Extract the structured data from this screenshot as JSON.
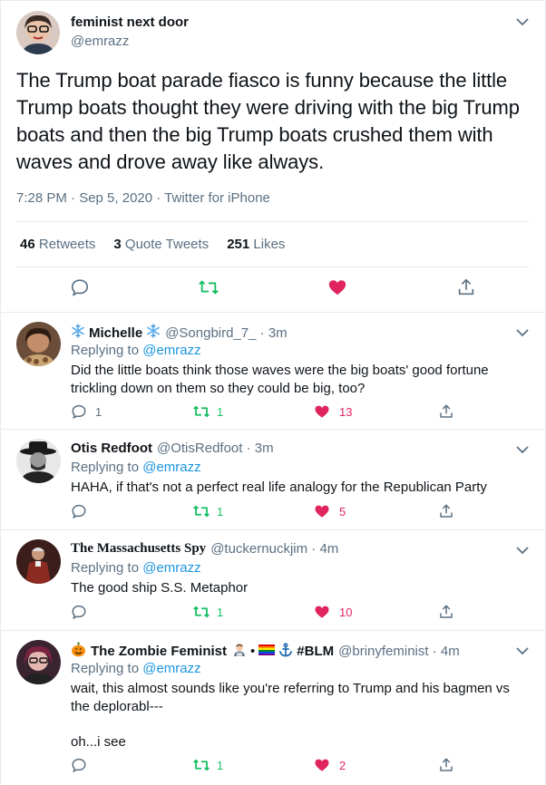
{
  "main_tweet": {
    "author_name": "feminist next door",
    "author_handle": "@emrazz",
    "text": "The Trump boat parade fiasco is funny because the little Trump boats thought they were driving with the big Trump boats and then the big Trump boats crushed them with waves and drove away like always.",
    "meta": "7:28 PM · Sep 5, 2020 · Twitter for iPhone",
    "stats": {
      "retweets_count": "46",
      "retweets_label": "Retweets",
      "quotes_count": "3",
      "quotes_label": "Quote Tweets",
      "likes_count": "251",
      "likes_label": "Likes"
    }
  },
  "replies": [
    {
      "name": "Michelle",
      "handle": "@Songbird_7_",
      "time": "· 3m",
      "replying_prefix": "Replying to",
      "replying_to": "@emrazz",
      "text": "Did the little boats think those waves were the big boats' good fortune trickling down on them so they could be big, too?",
      "reply_count": "1",
      "retweet_count": "1",
      "like_count": "13"
    },
    {
      "name": "Otis Redfoot",
      "handle": "@OtisRedfoot",
      "time": "· 3m",
      "replying_prefix": "Replying to",
      "replying_to": "@emrazz",
      "text": "HAHA, if that's not a perfect real life analogy for the Republican Party",
      "reply_count": "",
      "retweet_count": "1",
      "like_count": "5"
    },
    {
      "name": "The Massachusetts Spy",
      "handle": "@tuckernuckjim",
      "time": "· 4m",
      "replying_prefix": "Replying to",
      "replying_to": "@emrazz",
      "text": "The good ship S.S. Metaphor",
      "reply_count": "",
      "retweet_count": "1",
      "like_count": "10"
    },
    {
      "name": "The Zombie Feminist",
      "name_suffix": "#BLM",
      "handle": "@brinyfeminist",
      "time": "· 4m",
      "replying_prefix": "Replying to",
      "replying_to": "@emrazz",
      "text_line1": "wait, this almost sounds like you're referring to Trump and his bagmen vs the deplorabl---",
      "text_line2": "oh...i see",
      "reply_count": "",
      "retweet_count": "1",
      "like_count": "2"
    }
  ],
  "colors": {
    "text": "#0f1419",
    "secondary": "#5b7083",
    "link": "#1b95e0",
    "retweet_green": "#17bf63",
    "like_red": "#e0245e",
    "divider": "#e6ecf0"
  },
  "icons": [
    "chevron-down-icon",
    "reply-icon",
    "retweet-icon",
    "like-icon",
    "share-icon",
    "snowflake-icon",
    "pumpkin-icon",
    "rainbow-flag-icon",
    "anchor-icon",
    "technologist-icon"
  ]
}
